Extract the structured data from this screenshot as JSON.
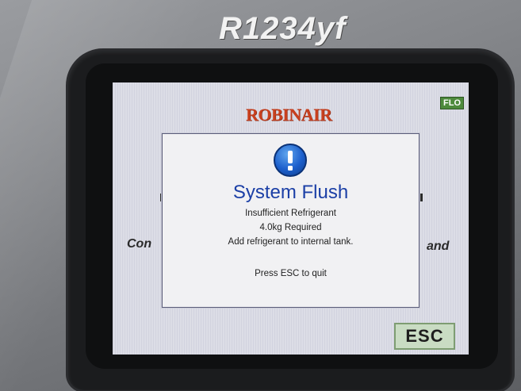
{
  "device": {
    "model_label": "R1234yf"
  },
  "screen": {
    "brand": "Robinair",
    "mode_badge": "FLO",
    "background_text_left": "Con",
    "background_text_right": "and"
  },
  "dialog": {
    "icon": "exclamation-icon",
    "title": "System Flush",
    "lines": [
      "Insufficient Refrigerant",
      "4.0kg Required",
      "Add refrigerant to internal tank."
    ],
    "hint": "Press ESC to quit"
  },
  "esc_button": {
    "label": "ESC"
  },
  "colors": {
    "title_blue": "#1b3fa6",
    "brand_red": "#c8401f",
    "badge_green": "#4d8a3c",
    "esc_bg": "#c9dcc3"
  }
}
